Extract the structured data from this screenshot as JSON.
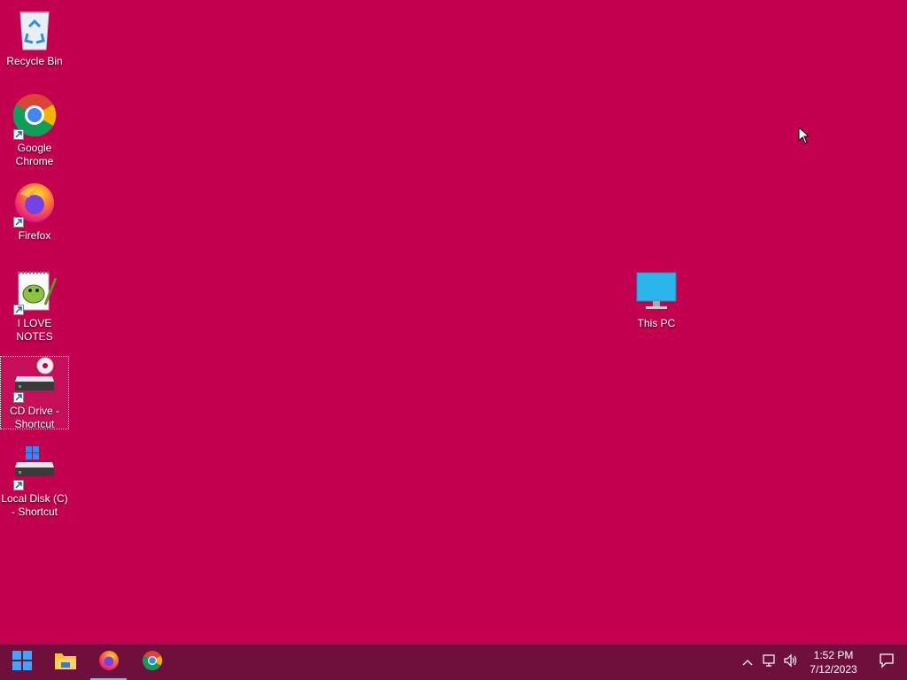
{
  "desktop": {
    "background_color": "#c3004f",
    "icons": [
      {
        "name": "recycle-bin",
        "label": "Recycle Bin",
        "shortcut": false
      },
      {
        "name": "chrome-shortcut",
        "label": "Google Chrome",
        "shortcut": true
      },
      {
        "name": "firefox-shortcut",
        "label": "Firefox",
        "shortcut": true
      },
      {
        "name": "notepad-shortcut",
        "label": "I LOVE NOTES",
        "shortcut": true
      },
      {
        "name": "cd-drive-shortcut",
        "label": "CD Drive - Shortcut",
        "shortcut": true,
        "selected": true
      },
      {
        "name": "local-disk-shortcut",
        "label": "Local Disk (C) - Shortcut",
        "shortcut": true
      },
      {
        "name": "this-pc",
        "label": "This PC",
        "shortcut": false
      }
    ]
  },
  "taskbar": {
    "color": "#6e0f3c",
    "pinned": [
      {
        "name": "start",
        "icon": "windows-logo-icon"
      },
      {
        "name": "file-explorer",
        "icon": "folder-icon"
      },
      {
        "name": "firefox",
        "icon": "firefox-icon",
        "active": true
      },
      {
        "name": "chrome",
        "icon": "chrome-icon"
      }
    ],
    "clock": {
      "time": "1:52 PM",
      "date": "7/12/2023"
    },
    "tray_icons": [
      "chevron-up-icon",
      "network-icon",
      "volume-icon",
      "notification-icon"
    ]
  }
}
